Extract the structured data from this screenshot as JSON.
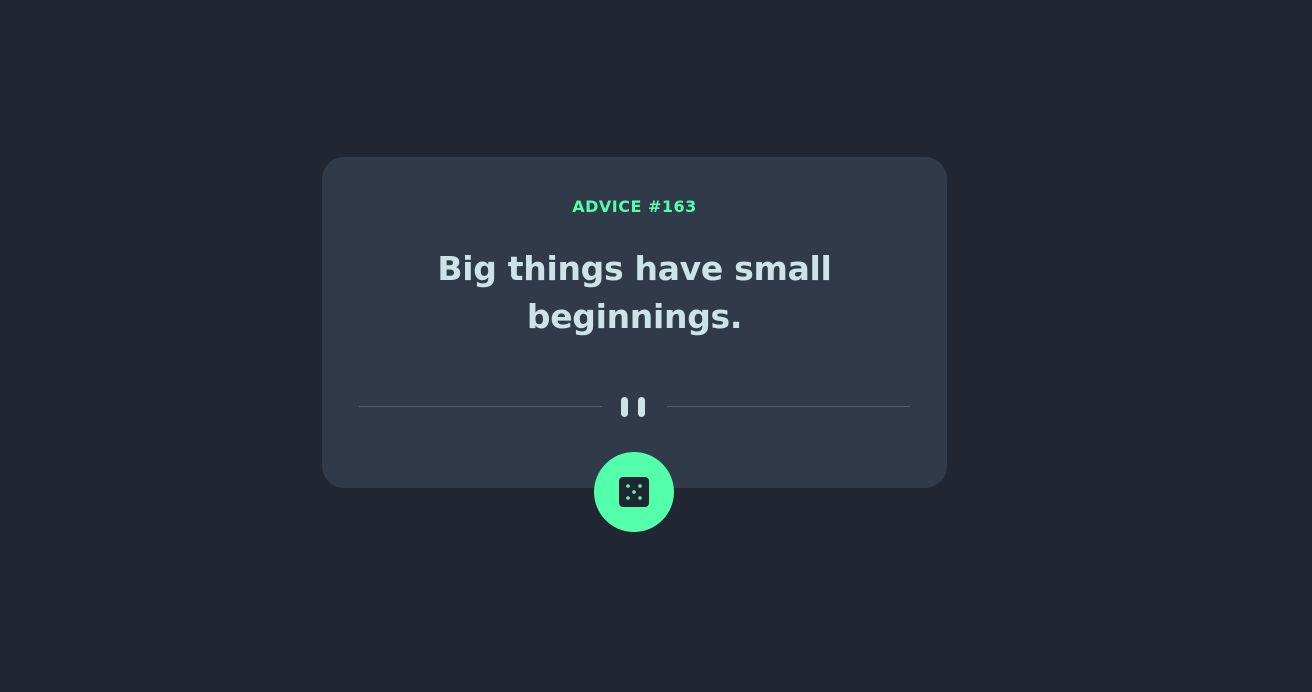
{
  "card": {
    "advice_label": "ADVICE #163",
    "advice_text": "Big things have small beginnings."
  },
  "divider": {
    "icon": "pause-icon"
  },
  "dice_button": {
    "icon": "dice-icon"
  },
  "colors": {
    "background": "#202632",
    "card": "#313a48",
    "accent": "#53ffaa",
    "text": "#cee3e9",
    "divider": "#4f5d74"
  }
}
